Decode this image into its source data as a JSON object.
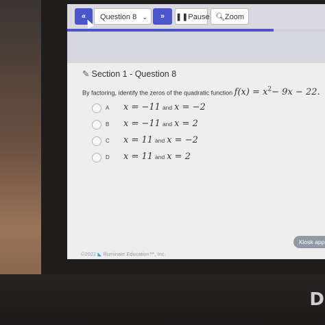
{
  "toolbar": {
    "prev_icon": "«",
    "question_select_value": "Question 8",
    "next_icon": "»",
    "pause_label": "❚❚Pause",
    "zoom_label": "🔍︎Zoom",
    "progress": 0.8
  },
  "question": {
    "section_title": "Section 1 - Question 8",
    "prompt_text": "By factoring, identify the zeros of the quadratic function",
    "function_text": "f(x) = x",
    "function_exp": "2",
    "function_rest": "− 9x − 22."
  },
  "choices": [
    {
      "letter": "A",
      "left": "x = −11",
      "and": "and",
      "right": "x = −2"
    },
    {
      "letter": "B",
      "left": "x = −11",
      "and": "and",
      "right": "x = 2"
    },
    {
      "letter": "C",
      "left": "x = 11",
      "and": "and",
      "right": "x = −2"
    },
    {
      "letter": "D",
      "left": "x = 11",
      "and": "and",
      "right": "x = 2"
    }
  ],
  "kiosk_label": "Kiosk app",
  "footer": {
    "copyright": "©2022",
    "company": "Illuminate Education™, Inc."
  },
  "brand_letter": "D",
  "colors": {
    "accent": "#4a56c9"
  }
}
